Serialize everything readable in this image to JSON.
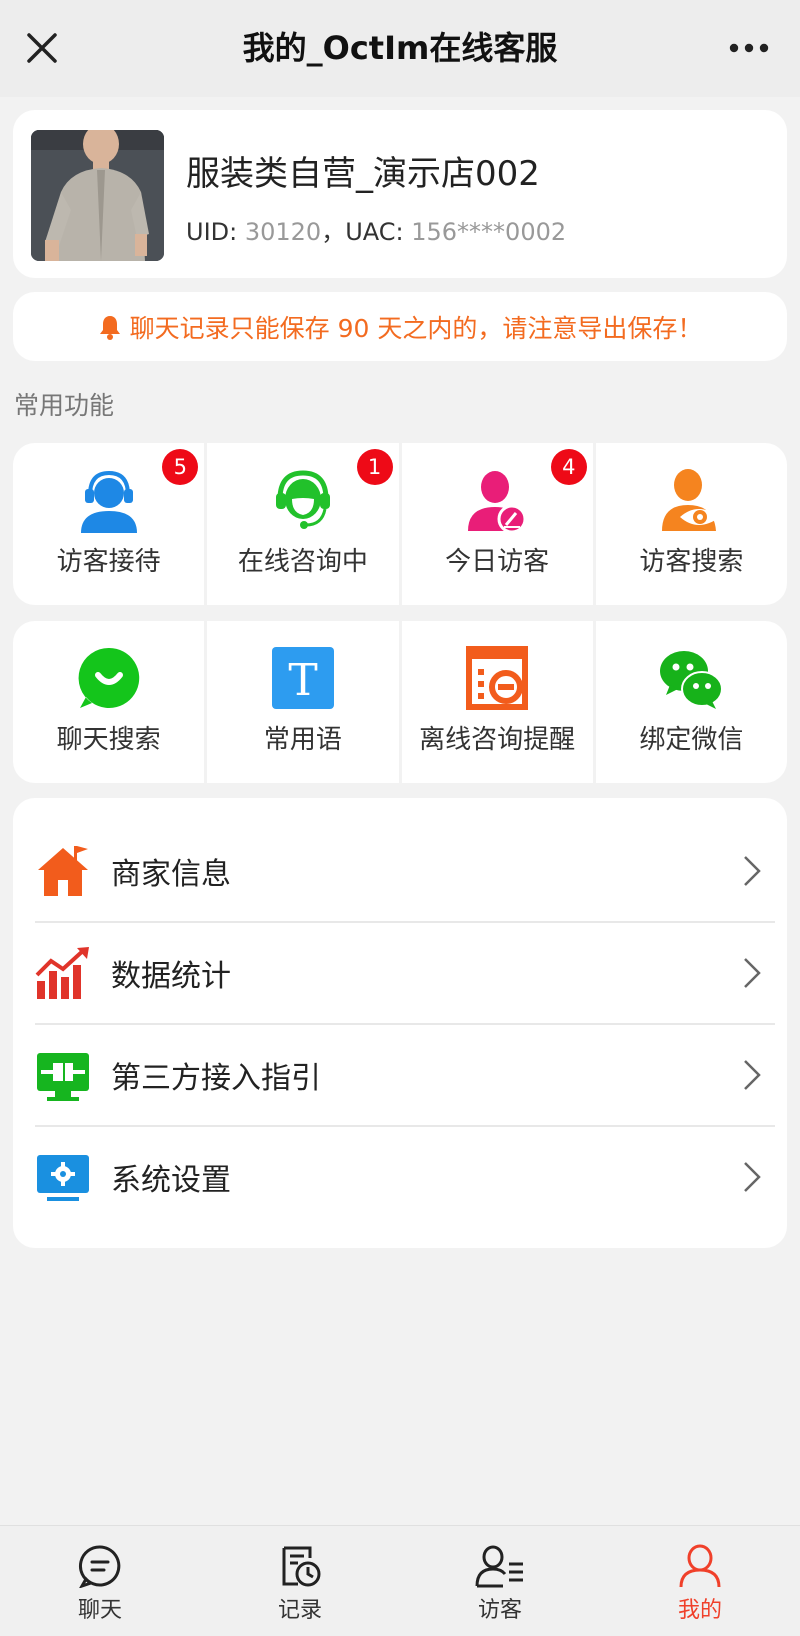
{
  "header": {
    "title": "我的_OctIm在线客服"
  },
  "profile": {
    "shop_name": "服装类自营_演示店002",
    "uid_label": "UID: ",
    "uid_value": "30120",
    "sep": "，",
    "uac_label": "UAC: ",
    "uac_value": "156****0002"
  },
  "notice": {
    "text": "聊天记录只能保存 90 天之内的，请注意导出保存！",
    "color": "#f36b20"
  },
  "section_title": "常用功能",
  "functions_row1": [
    {
      "label": "访客接待",
      "badge": "5",
      "icon": "headset-user-icon",
      "color": "#1e88e5"
    },
    {
      "label": "在线咨询中",
      "badge": "1",
      "icon": "support-agent-icon",
      "color": "#22c12b"
    },
    {
      "label": "今日访客",
      "badge": "4",
      "icon": "user-edit-icon",
      "color": "#e91e78"
    },
    {
      "label": "访客搜索",
      "icon": "user-eye-icon",
      "color": "#f5841f"
    }
  ],
  "functions_row2": [
    {
      "label": "聊天搜索",
      "icon": "chat-smile-icon",
      "color": "#14c51b"
    },
    {
      "label": "常用语",
      "icon": "text-t-icon",
      "color": "#2d9cf0"
    },
    {
      "label": "离线咨询提醒",
      "icon": "offline-notice-icon",
      "color": "#f25c1c"
    },
    {
      "label": "绑定微信",
      "icon": "wechat-icon",
      "color": "#17b21a"
    }
  ],
  "menu": [
    {
      "label": "商家信息",
      "icon": "shop-home-icon"
    },
    {
      "label": "数据统计",
      "icon": "statistics-chart-icon"
    },
    {
      "label": "第三方接入指引",
      "icon": "plug-connect-icon"
    },
    {
      "label": "系统设置",
      "icon": "settings-monitor-icon"
    }
  ],
  "tabs": [
    {
      "label": "聊天",
      "icon": "chat-icon"
    },
    {
      "label": "记录",
      "icon": "record-clock-icon"
    },
    {
      "label": "访客",
      "icon": "visitor-list-icon"
    },
    {
      "label": "我的",
      "icon": "profile-icon",
      "active": true
    }
  ],
  "colors": {
    "accent": "#f0402a",
    "badge": "#ee0a17"
  }
}
